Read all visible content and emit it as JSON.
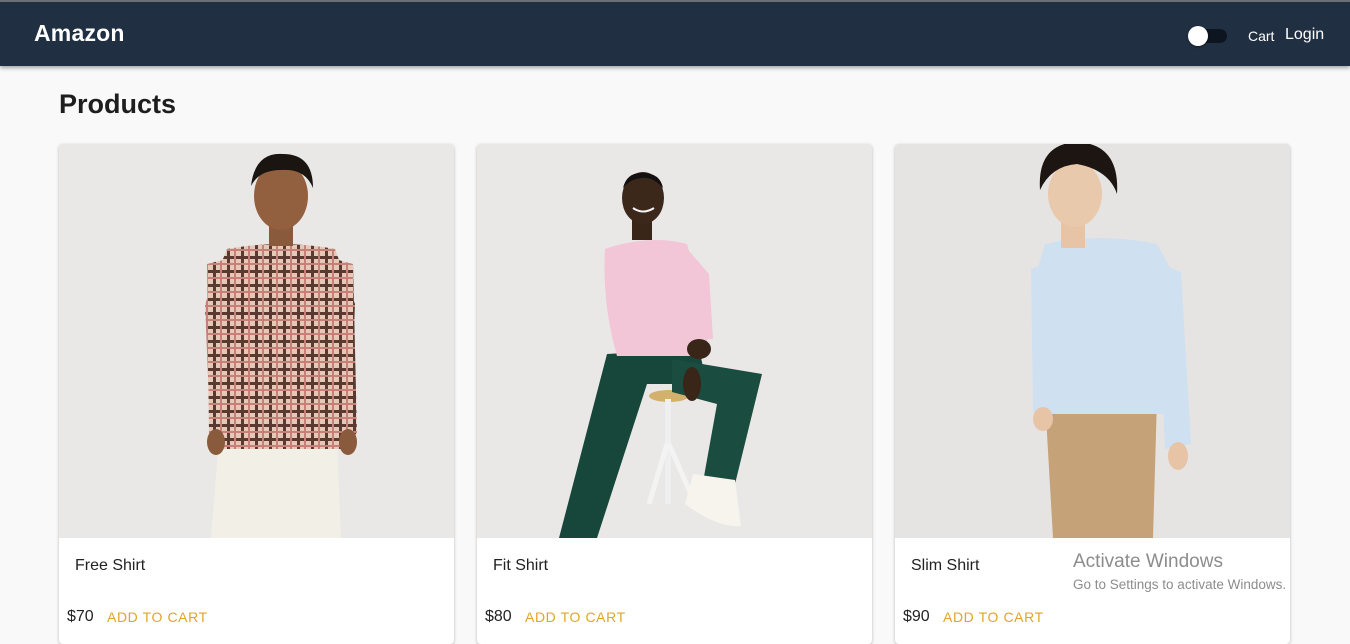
{
  "header": {
    "brand": "Amazon",
    "cart_label": "Cart",
    "login_label": "Login",
    "theme_toggle": {
      "state": "off",
      "icon": "toggle-switch"
    }
  },
  "main": {
    "title": "Products",
    "products": [
      {
        "name": "Free Shirt",
        "price": "$70",
        "action": "ADD TO CART",
        "image": "model-plaid-shirt"
      },
      {
        "name": "Fit Shirt",
        "price": "$80",
        "action": "ADD TO CART",
        "image": "model-pink-shirt-seated"
      },
      {
        "name": "Slim Shirt",
        "price": "$90",
        "action": "ADD TO CART",
        "image": "model-blue-shirt"
      }
    ]
  },
  "watermark": {
    "title": "Activate Windows",
    "subtitle": "Go to Settings to activate Windows."
  },
  "colors": {
    "header_bg": "#212f42",
    "accent": "#e0a526",
    "page_bg": "#f9f9f9",
    "card_bg": "#ffffff"
  }
}
